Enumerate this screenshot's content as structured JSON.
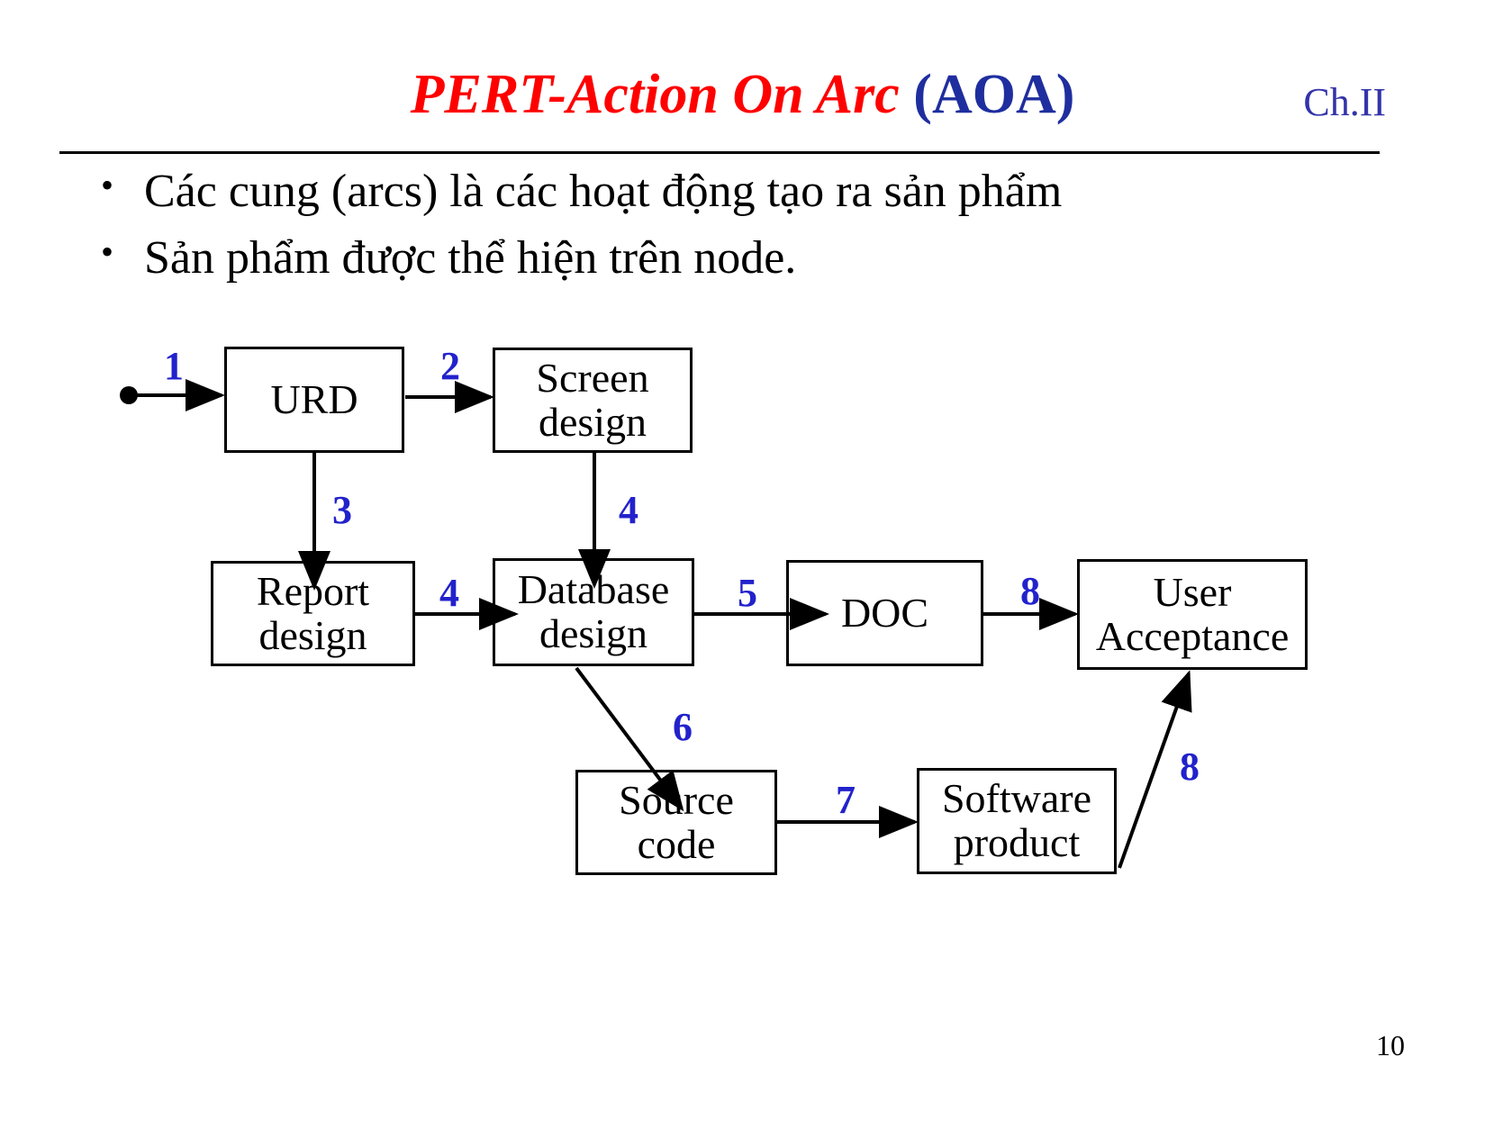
{
  "slide": {
    "title_primary": "PERT-Action On Arc",
    "title_secondary": "(AOA)",
    "chapter": "Ch.II",
    "page_number": "10",
    "bullet_marker": "•",
    "colors": {
      "title_primary": "#FF0000",
      "title_secondary": "#1F2E9E",
      "chapter": "#3333AA",
      "edge_label": "#2222CC",
      "node_border": "#000000",
      "text": "#000000",
      "background": "#FFFFFF"
    }
  },
  "bullets": [
    {
      "text": "Các cung (arcs) là các hoạt động tạo ra sản phẩm"
    },
    {
      "text": "Sản phẩm được thể hiện trên node."
    }
  ],
  "diagram": {
    "type": "pert-aoa-network",
    "start_node_label": "",
    "nodes": [
      {
        "id": "urd",
        "label": "URD"
      },
      {
        "id": "screen",
        "label": "Screen design"
      },
      {
        "id": "report",
        "label": "Report design"
      },
      {
        "id": "database",
        "label": "Database design"
      },
      {
        "id": "doc",
        "label": "DOC"
      },
      {
        "id": "acceptance",
        "label": "User Acceptance"
      },
      {
        "id": "source",
        "label": "Source code"
      },
      {
        "id": "software",
        "label": "Software product"
      }
    ],
    "edges": [
      {
        "id": "e1",
        "label": "1",
        "from": "start",
        "to": "urd"
      },
      {
        "id": "e2",
        "label": "2",
        "from": "urd",
        "to": "screen"
      },
      {
        "id": "e3",
        "label": "3",
        "from": "urd",
        "to": "report"
      },
      {
        "id": "e4",
        "label": "4",
        "from": "screen",
        "to": "database"
      },
      {
        "id": "e5",
        "label": "4",
        "from": "report",
        "to": "database"
      },
      {
        "id": "e6",
        "label": "5",
        "from": "database",
        "to": "doc"
      },
      {
        "id": "e7",
        "label": "8",
        "from": "doc",
        "to": "acceptance"
      },
      {
        "id": "e8",
        "label": "6",
        "from": "database",
        "to": "source"
      },
      {
        "id": "e9",
        "label": "7",
        "from": "source",
        "to": "software"
      },
      {
        "id": "e10",
        "label": "8",
        "from": "software",
        "to": "acceptance"
      }
    ]
  }
}
